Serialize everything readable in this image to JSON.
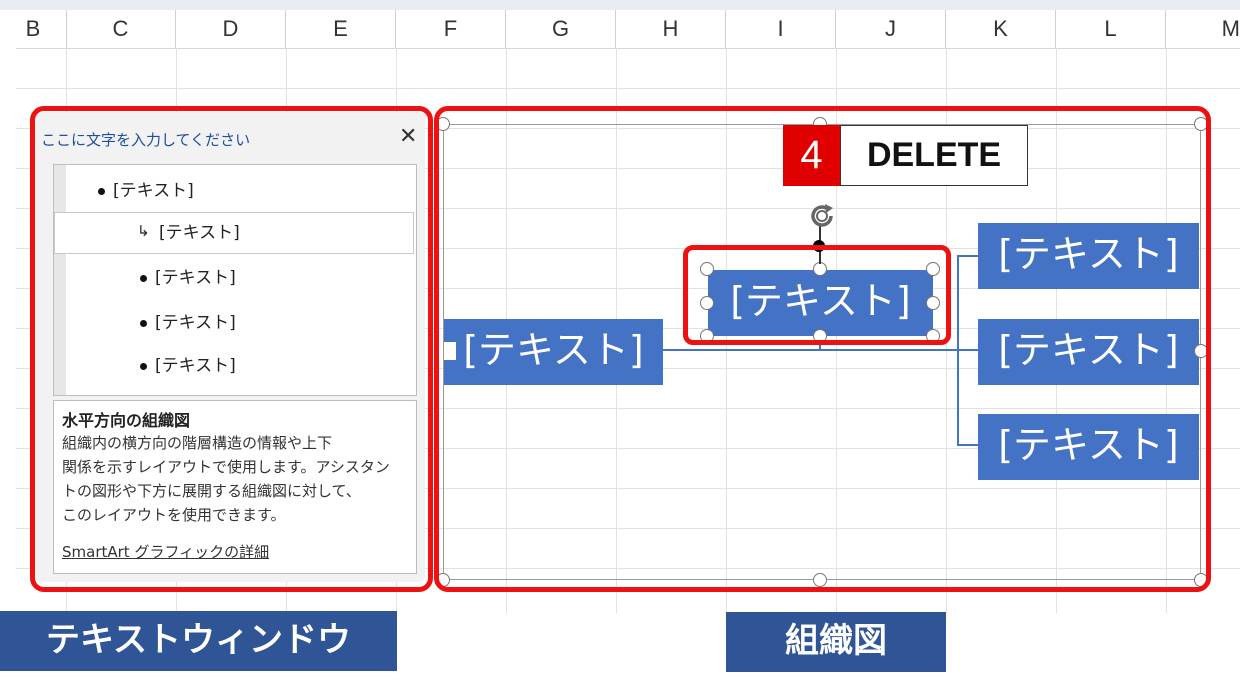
{
  "columns": [
    "B",
    "C",
    "D",
    "E",
    "F",
    "G",
    "H",
    "I",
    "J",
    "K",
    "L",
    "M"
  ],
  "text_pane": {
    "title": "ここに文字を入力してください",
    "close_icon": "close-icon",
    "items": [
      {
        "level": 1,
        "text": "[テキスト]",
        "marker": "•"
      },
      {
        "level": 2,
        "text": "[テキスト]",
        "marker": "↳",
        "selected": true
      },
      {
        "level": 2,
        "text": "[テキスト]",
        "marker": "•"
      },
      {
        "level": 2,
        "text": "[テキスト]",
        "marker": "•"
      },
      {
        "level": 2,
        "text": "[テキスト]",
        "marker": "•"
      }
    ],
    "description_title": "水平方向の組織図",
    "description_lines": [
      "組織内の横方向の階層構造の情報や上下",
      "関係を示すレイアウトで使用します。アシスタン",
      "トの図形や下方に展開する組織図に対して、",
      "このレイアウトを使用できます。"
    ],
    "link": "SmartArt グラフィックの詳細"
  },
  "smartart": {
    "root": "[テキスト]",
    "assistant": "[テキスト]",
    "children": [
      "[テキスト]",
      "[テキスト]",
      "[テキスト]"
    ],
    "rotate_icon": "rotate-icon"
  },
  "step_badge": {
    "number": "4",
    "label": "DELETE"
  },
  "captions": {
    "left": "テキストウィンドウ",
    "right": "組織図"
  },
  "colors": {
    "accent_red": "#ee1111",
    "node_blue": "#4472c4",
    "caption_blue": "#2f5597"
  }
}
